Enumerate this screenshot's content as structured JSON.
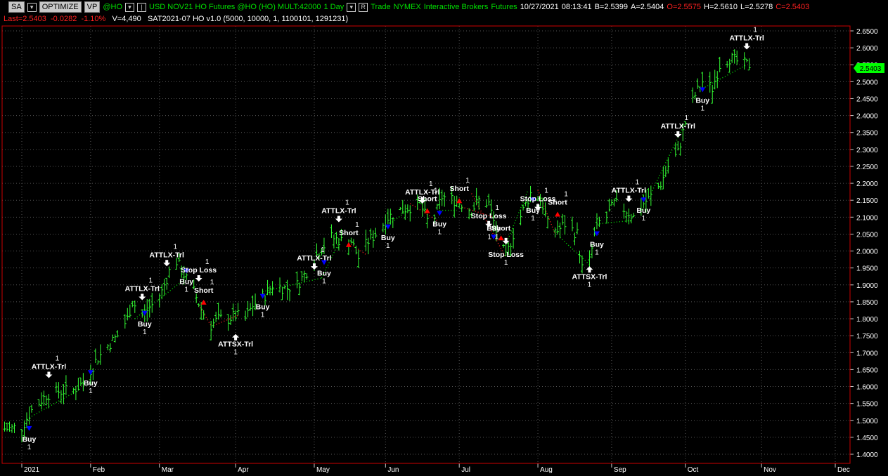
{
  "toolbar": {
    "buttons": [
      "SA",
      "OPTIMIZE",
      "VP"
    ],
    "symbol": "@HO",
    "description": "USD NOV21 HO Futures @HO (HO) MULT:42000",
    "interval": "1 Day",
    "mode_button": "R",
    "trade": "Trade",
    "exchange": "NYMEX",
    "broker": "Interactive Brokers",
    "asset": "Futures",
    "date": "10/27/2021",
    "time": "08:13:41",
    "bid": "B=2.5399",
    "ask": "A=2.5404",
    "open": "O=2.5575",
    "high": "H=2.5610",
    "low": "L=2.5278",
    "close": "C=2.5403"
  },
  "status": {
    "last": "Last=2.5403",
    "change": "-0.0282",
    "pct": "-1.10%",
    "volume": "V=4,490",
    "strategy": "SAT2021-07 HO v1.0 (5000,  10000,  1,  1100101,  1291231)"
  },
  "colors": {
    "bar": "#33ff33",
    "long_dot": "#00dd00",
    "short_dot": "#ff2020",
    "long_entry": "#0000ff",
    "short_entry": "#ff0000",
    "price_tag": "#00ff00",
    "text": "#ffffff",
    "border": "#cc0000"
  },
  "chart_data": {
    "type": "ohlc",
    "last_price": "2.5403",
    "y_ticks": [
      "2.6500",
      "2.6000",
      "2.5500",
      "2.5000",
      "2.4500",
      "2.4000",
      "2.3500",
      "2.3000",
      "2.2500",
      "2.2000",
      "2.1500",
      "2.1000",
      "2.0500",
      "2.0000",
      "1.9500",
      "1.9000",
      "1.8500",
      "1.8000",
      "1.7500",
      "1.7000",
      "1.6500",
      "1.6000",
      "1.5500",
      "1.5000",
      "1.4500",
      "1.4000"
    ],
    "x_ticks": [
      {
        "label": "2021",
        "date": "2021-01-04"
      },
      {
        "label": "Feb",
        "date": "2021-02-01"
      },
      {
        "label": "Mar",
        "date": "2021-03-01"
      },
      {
        "label": "Apr",
        "date": "2021-04-01"
      },
      {
        "label": "May",
        "date": "2021-05-03"
      },
      {
        "label": "Jun",
        "date": "2021-06-01"
      },
      {
        "label": "Jul",
        "date": "2021-07-01"
      },
      {
        "label": "Aug",
        "date": "2021-08-02"
      },
      {
        "label": "Sep",
        "date": "2021-09-01"
      },
      {
        "label": "Oct",
        "date": "2021-10-01"
      },
      {
        "label": "Nov",
        "date": "2021-11-01"
      },
      {
        "label": "Dec",
        "date": "2021-12-01"
      }
    ],
    "price_path": [
      [
        "2020-12-28",
        1.475
      ],
      [
        "2021-01-04",
        1.48
      ],
      [
        "2021-01-08",
        1.53
      ],
      [
        "2021-01-14",
        1.575
      ],
      [
        "2021-01-19",
        1.585
      ],
      [
        "2021-01-25",
        1.59
      ],
      [
        "2021-01-29",
        1.61
      ],
      [
        "2021-02-03",
        1.675
      ],
      [
        "2021-02-08",
        1.72
      ],
      [
        "2021-02-12",
        1.75
      ],
      [
        "2021-02-16",
        1.8
      ],
      [
        "2021-02-18",
        1.85
      ],
      [
        "2021-02-22",
        1.81
      ],
      [
        "2021-02-26",
        1.84
      ],
      [
        "2021-03-02",
        1.88
      ],
      [
        "2021-03-05",
        1.94
      ],
      [
        "2021-03-08",
        1.97
      ],
      [
        "2021-03-11",
        1.93
      ],
      [
        "2021-03-15",
        1.88
      ],
      [
        "2021-03-18",
        1.83
      ],
      [
        "2021-03-22",
        1.78
      ],
      [
        "2021-03-25",
        1.8
      ],
      [
        "2021-03-29",
        1.8
      ],
      [
        "2021-04-01",
        1.81
      ],
      [
        "2021-04-05",
        1.8
      ],
      [
        "2021-04-08",
        1.84
      ],
      [
        "2021-04-12",
        1.86
      ],
      [
        "2021-04-16",
        1.9
      ],
      [
        "2021-04-21",
        1.89
      ],
      [
        "2021-04-26",
        1.9
      ],
      [
        "2021-04-30",
        1.94
      ],
      [
        "2021-05-05",
        2.0
      ],
      [
        "2021-05-10",
        2.04
      ],
      [
        "2021-05-14",
        2.03
      ],
      [
        "2021-05-18",
        2.03
      ],
      [
        "2021-05-21",
        1.98
      ],
      [
        "2021-05-25",
        2.03
      ],
      [
        "2021-05-28",
        2.05
      ],
      [
        "2021-06-02",
        2.1
      ],
      [
        "2021-06-07",
        2.12
      ],
      [
        "2021-06-11",
        2.13
      ],
      [
        "2021-06-15",
        2.14
      ],
      [
        "2021-06-18",
        2.09
      ],
      [
        "2021-06-21",
        2.1
      ],
      [
        "2021-06-24",
        2.16
      ],
      [
        "2021-06-29",
        2.15
      ],
      [
        "2021-07-02",
        2.14
      ],
      [
        "2021-07-06",
        2.12
      ],
      [
        "2021-07-09",
        2.15
      ],
      [
        "2021-07-13",
        2.14
      ],
      [
        "2021-07-16",
        2.06
      ],
      [
        "2021-07-20",
        1.98
      ],
      [
        "2021-07-23",
        2.05
      ],
      [
        "2021-07-27",
        2.12
      ],
      [
        "2021-07-30",
        2.17
      ],
      [
        "2021-08-03",
        2.16
      ],
      [
        "2021-08-06",
        2.08
      ],
      [
        "2021-08-10",
        2.06
      ],
      [
        "2021-08-13",
        2.08
      ],
      [
        "2021-08-18",
        2.05
      ],
      [
        "2021-08-20",
        1.95
      ],
      [
        "2021-08-23",
        1.97
      ],
      [
        "2021-08-26",
        2.08
      ],
      [
        "2021-08-30",
        2.1
      ],
      [
        "2021-09-02",
        2.14
      ],
      [
        "2021-09-07",
        2.12
      ],
      [
        "2021-09-10",
        2.1
      ],
      [
        "2021-09-14",
        2.14
      ],
      [
        "2021-09-17",
        2.16
      ],
      [
        "2021-09-21",
        2.2
      ],
      [
        "2021-09-24",
        2.25
      ],
      [
        "2021-09-28",
        2.29
      ],
      [
        "2021-10-01",
        2.38
      ],
      [
        "2021-10-05",
        2.46
      ],
      [
        "2021-10-08",
        2.5
      ],
      [
        "2021-10-12",
        2.48
      ],
      [
        "2021-10-15",
        2.55
      ],
      [
        "2021-10-19",
        2.57
      ],
      [
        "2021-10-22",
        2.56
      ],
      [
        "2021-10-26",
        2.55
      ]
    ],
    "bar_start": "2020-12-28",
    "bar_end": "2021-10-27",
    "bar_spread": 0.035,
    "trail_segments": [
      {
        "side": "long",
        "from": [
          "2021-01-05",
          1.5
        ],
        "to": [
          "2021-01-26",
          1.585
        ]
      },
      {
        "side": "long",
        "from": [
          "2021-02-19",
          1.8
        ],
        "to": [
          "2021-03-10",
          1.91
        ]
      },
      {
        "side": "short",
        "from": [
          "2021-03-17",
          1.84
        ],
        "to": [
          "2021-03-22",
          1.78
        ]
      },
      {
        "side": "short",
        "from": [
          "2021-03-23",
          1.78
        ],
        "to": [
          "2021-04-02",
          1.81
        ]
      },
      {
        "side": "long",
        "from": [
          "2021-04-12",
          1.88
        ],
        "to": [
          "2021-05-06",
          1.92
        ]
      },
      {
        "side": "long",
        "from": [
          "2021-05-06",
          1.92
        ],
        "to": [
          "2021-05-14",
          2.04
        ]
      },
      {
        "side": "short",
        "from": [
          "2021-05-18",
          2.02
        ],
        "to": [
          "2021-05-24",
          1.99
        ]
      },
      {
        "side": "long",
        "from": [
          "2021-06-01",
          2.07
        ],
        "to": [
          "2021-06-10",
          2.12
        ]
      },
      {
        "side": "short",
        "from": [
          "2021-06-11",
          2.14
        ],
        "to": [
          "2021-06-22",
          2.09
        ]
      },
      {
        "side": "long",
        "from": [
          "2021-06-23",
          2.12
        ],
        "to": [
          "2021-06-30",
          2.12
        ]
      },
      {
        "side": "short",
        "from": [
          "2021-07-02",
          2.13
        ],
        "to": [
          "2021-07-15",
          2.1
        ]
      },
      {
        "side": "short",
        "from": [
          "2021-07-06",
          2.17
        ],
        "to": [
          "2021-07-20",
          1.98
        ]
      },
      {
        "side": "long",
        "from": [
          "2021-07-20",
          2.02
        ],
        "to": [
          "2021-07-29",
          2.18
        ]
      },
      {
        "side": "short",
        "from": [
          "2021-08-02",
          2.18
        ],
        "to": [
          "2021-08-09",
          2.05
        ]
      },
      {
        "side": "long",
        "from": [
          "2021-08-11",
          2.04
        ],
        "to": [
          "2021-08-23",
          1.96
        ]
      },
      {
        "side": "long",
        "from": [
          "2021-08-26",
          2.08
        ],
        "to": [
          "2021-09-09",
          2.09
        ]
      },
      {
        "side": "long",
        "from": [
          "2021-09-17",
          2.17
        ],
        "to": [
          "2021-10-01",
          2.38
        ]
      },
      {
        "side": "long",
        "from": [
          "2021-10-08",
          2.48
        ],
        "to": [
          "2021-10-26",
          2.55
        ]
      }
    ],
    "signals": [
      {
        "label": "Buy",
        "qty": "1",
        "date": "2021-01-07",
        "price": 1.475,
        "kind": "long_entry",
        "text_pos": "below"
      },
      {
        "label": "ATTLX-Trl",
        "qty": "1",
        "date": "2021-01-15",
        "price": 1.625,
        "kind": "exit_down",
        "text_pos": "above"
      },
      {
        "label": "Buy",
        "qty": "1",
        "date": "2021-02-01",
        "price": 1.64,
        "kind": "long_entry",
        "text_pos": "below"
      },
      {
        "label": "ATTLX-Trl",
        "qty": "1",
        "date": "2021-02-22",
        "price": 1.855,
        "kind": "exit_down",
        "text_pos": "above"
      },
      {
        "label": "Buy",
        "qty": "1",
        "date": "2021-02-23",
        "price": 1.815,
        "kind": "long_entry",
        "text_pos": "below"
      },
      {
        "label": "ATTLX-Trl",
        "qty": "1",
        "date": "2021-03-04",
        "price": 1.955,
        "kind": "exit_down",
        "text_pos": "above"
      },
      {
        "label": "Buy",
        "qty": "1",
        "date": "2021-03-12",
        "price": 1.94,
        "kind": "long_entry",
        "text_pos": "below"
      },
      {
        "label": "Stop Loss",
        "qty": "1",
        "date": "2021-03-17",
        "price": 1.91,
        "kind": "stop",
        "text_pos": "above"
      },
      {
        "label": "Short",
        "qty": "1",
        "date": "2021-03-19",
        "price": 1.85,
        "kind": "short_entry",
        "text_pos": "above"
      },
      {
        "label": "ATTSX-Trl",
        "qty": "1",
        "date": "2021-04-01",
        "price": 1.755,
        "kind": "exit_up",
        "text_pos": "below"
      },
      {
        "label": "Buy",
        "qty": "1",
        "date": "2021-04-12",
        "price": 1.865,
        "kind": "long_entry",
        "text_pos": "below"
      },
      {
        "label": "ATTLX-Trl",
        "qty": "1",
        "date": "2021-05-03",
        "price": 1.945,
        "kind": "exit_down",
        "text_pos": "above"
      },
      {
        "label": "Buy",
        "qty": "1",
        "date": "2021-05-07",
        "price": 1.965,
        "kind": "long_entry",
        "text_pos": "below"
      },
      {
        "label": "ATTLX-Trl",
        "qty": "1",
        "date": "2021-05-13",
        "price": 2.085,
        "kind": "exit_down",
        "text_pos": "above"
      },
      {
        "label": "Short",
        "qty": "1",
        "date": "2021-05-17",
        "price": 2.02,
        "kind": "short_entry",
        "text_pos": "above"
      },
      {
        "label": "Buy",
        "qty": "1",
        "date": "2021-06-02",
        "price": 2.07,
        "kind": "long_entry",
        "text_pos": "below"
      },
      {
        "label": "ATTLX-Trl",
        "qty": "1",
        "date": "2021-06-16",
        "price": 2.14,
        "kind": "exit_down",
        "text_pos": "above"
      },
      {
        "label": "Short",
        "qty": "1",
        "date": "2021-06-18",
        "price": 2.12,
        "kind": "short_entry",
        "text_pos": "above"
      },
      {
        "label": "Buy",
        "qty": "1",
        "date": "2021-06-23",
        "price": 2.11,
        "kind": "long_entry",
        "text_pos": "below"
      },
      {
        "label": "Short",
        "qty": "1",
        "date": "2021-07-01",
        "price": 2.15,
        "kind": "short_entry",
        "text_pos": "above"
      },
      {
        "label": "Stop Loss",
        "qty": "1",
        "date": "2021-07-13",
        "price": 2.07,
        "kind": "stop",
        "text_pos": "above"
      },
      {
        "label": "Buy",
        "qty": "1",
        "date": "2021-07-15",
        "price": 2.04,
        "kind": "long_entry",
        "text_pos": "side"
      },
      {
        "label": "Short",
        "qty": "1",
        "date": "2021-07-18",
        "price": 2.04,
        "kind": "short_entry",
        "text_pos": "side"
      },
      {
        "label": "Stop Loss",
        "qty": "1",
        "date": "2021-07-20",
        "price": 2.02,
        "kind": "stop",
        "text_pos": "below"
      },
      {
        "label": "Buy",
        "qty": "1",
        "date": "2021-07-31",
        "price": 2.15,
        "kind": "long_entry",
        "text_pos": "below"
      },
      {
        "label": "Stop Loss",
        "qty": "1",
        "date": "2021-08-02",
        "price": 2.12,
        "kind": "stop",
        "text_pos": "above"
      },
      {
        "label": "Short",
        "qty": "1",
        "date": "2021-08-10",
        "price": 2.11,
        "kind": "short_entry",
        "text_pos": "above"
      },
      {
        "label": "ATTSX-Trl",
        "qty": "1",
        "date": "2021-08-23",
        "price": 1.955,
        "kind": "exit_up",
        "text_pos": "below"
      },
      {
        "label": "Buy",
        "qty": "1",
        "date": "2021-08-26",
        "price": 2.05,
        "kind": "long_entry",
        "text_pos": "below"
      },
      {
        "label": "ATTLX-Trl",
        "qty": "1",
        "date": "2021-09-08",
        "price": 2.145,
        "kind": "exit_down",
        "text_pos": "above"
      },
      {
        "label": "Buy",
        "qty": "1",
        "date": "2021-09-14",
        "price": 2.15,
        "kind": "long_entry",
        "text_pos": "below"
      },
      {
        "label": "ATTLX-Trl",
        "qty": "1",
        "date": "2021-09-28",
        "price": 2.335,
        "kind": "exit_down",
        "text_pos": "above"
      },
      {
        "label": "Buy",
        "qty": "1",
        "date": "2021-10-08",
        "price": 2.475,
        "kind": "long_entry",
        "text_pos": "below"
      },
      {
        "label": "ATTLX-Trl",
        "qty": "1",
        "date": "2021-10-26",
        "price": 2.595,
        "kind": "exit_down",
        "text_pos": "above"
      }
    ]
  }
}
